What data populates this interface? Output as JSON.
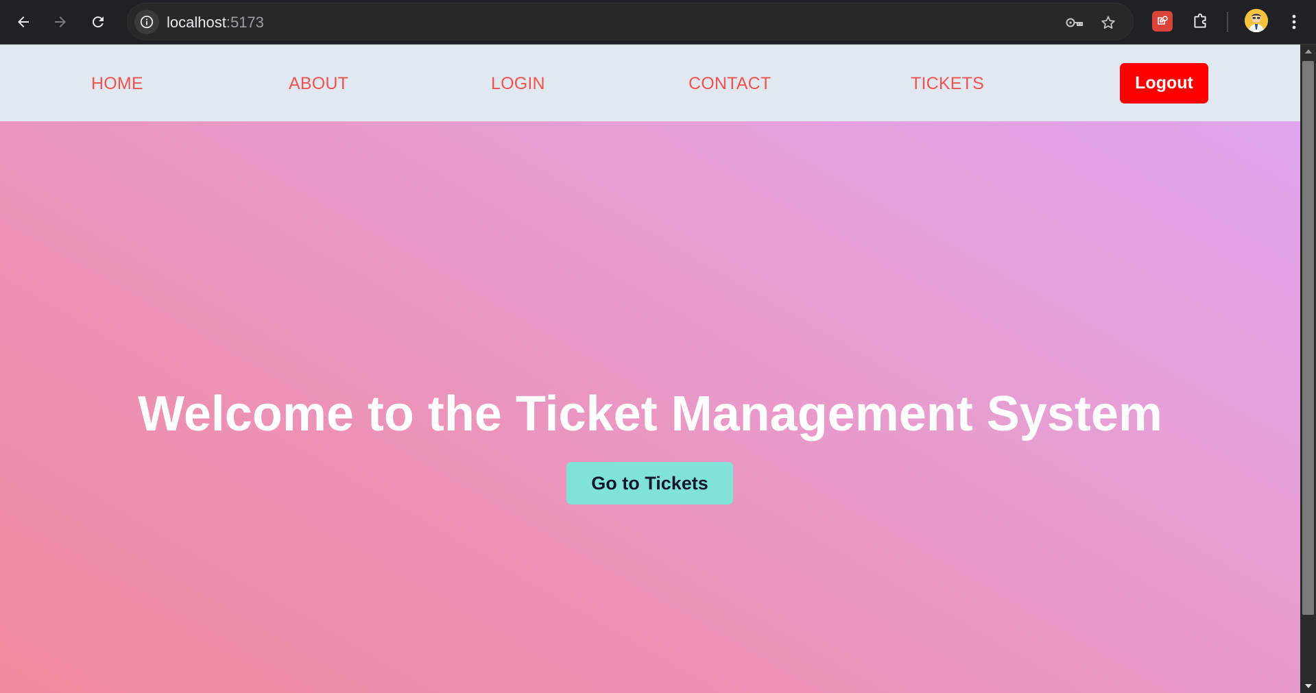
{
  "browser": {
    "url_host": "localhost",
    "url_port": ":5173",
    "icons": {
      "back": "arrow-left-icon",
      "forward": "arrow-right-icon",
      "reload": "reload-icon",
      "site_info": "info-icon",
      "password": "key-icon",
      "bookmark": "star-icon",
      "extension": "extension-badge-icon",
      "extensions_menu": "puzzle-icon",
      "profile": "avatar-icon",
      "menu": "kebab-menu-icon"
    }
  },
  "navbar": {
    "links": [
      "HOME",
      "ABOUT",
      "LOGIN",
      "CONTACT",
      "TICKETS"
    ],
    "logout_label": "Logout",
    "background": "#e2e8f0",
    "link_color": "#ef5350",
    "logout_color": "#ff0000"
  },
  "hero": {
    "title": "Welcome to the Ticket Management System",
    "button_label": "Go to Tickets",
    "button_color": "#80e3d6",
    "gradient_start": "#f08a9e",
    "gradient_end": "#dfa4ed"
  }
}
